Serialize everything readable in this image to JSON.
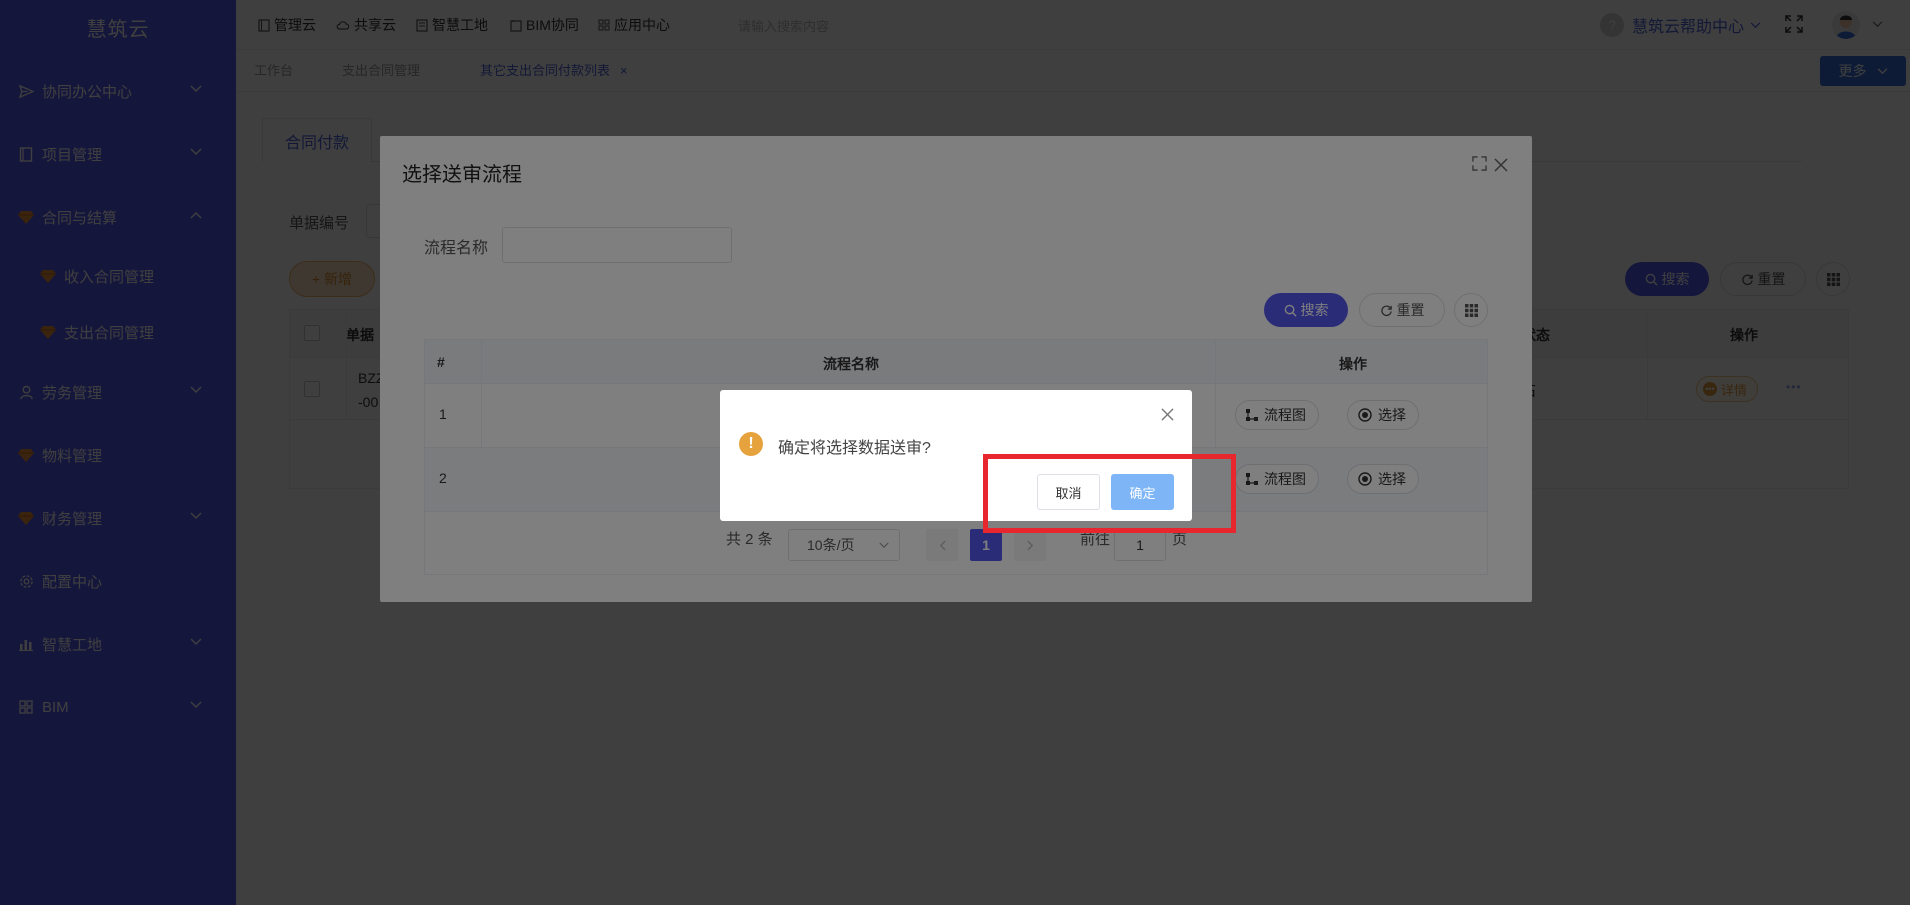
{
  "app": {
    "logo": "慧筑云"
  },
  "sidebar": {
    "items": [
      {
        "label": "协同办公中心",
        "icon": "send-icon",
        "expanded": false
      },
      {
        "label": "项目管理",
        "icon": "book-icon",
        "expanded": false
      },
      {
        "label": "合同与结算",
        "icon": "gem-icon",
        "expanded": true
      },
      {
        "label": "收入合同管理",
        "icon": "gem-icon"
      },
      {
        "label": "支出合同管理",
        "icon": "gem-icon"
      },
      {
        "label": "劳务管理",
        "icon": "worker-icon",
        "expanded": false
      },
      {
        "label": "物料管理",
        "icon": "gem-icon"
      },
      {
        "label": "财务管理",
        "icon": "gem-icon",
        "expanded": false
      },
      {
        "label": "配置中心",
        "icon": "gear-icon"
      },
      {
        "label": "智慧工地",
        "icon": "bar-chart-icon",
        "expanded": false
      },
      {
        "label": "BIM",
        "icon": "grid-icon",
        "expanded": false
      }
    ]
  },
  "topnav": {
    "items": [
      {
        "label": "管理云",
        "icon": "book-icon"
      },
      {
        "label": "共享云",
        "icon": "cloud-icon"
      },
      {
        "label": "智慧工地",
        "icon": "doc-icon"
      },
      {
        "label": "BIM协同",
        "icon": "folder-icon"
      },
      {
        "label": "应用中心",
        "icon": "grid-icon"
      }
    ],
    "search_placeholder": "请输入搜索内容",
    "help": "慧筑云帮助中心"
  },
  "tabs": [
    {
      "label": "工作台",
      "active": false
    },
    {
      "label": "支出合同管理",
      "active": false
    },
    {
      "label": "其它支出合同付款列表",
      "active": true,
      "close": "×"
    }
  ],
  "more_button": "更多",
  "page": {
    "content_tab": "合同付款",
    "filter_label": "单据编号",
    "add_button": "+ 新增",
    "search_button": "搜索",
    "reset_button": "重置",
    "table": {
      "header_cells": [
        "单据",
        "状态",
        "操作"
      ],
      "row_doc": "BZZ",
      "row_doc2": "-00",
      "row_status": "石",
      "detail_button": "详情",
      "more_dots": "•••"
    }
  },
  "dialog": {
    "title": "选择送审流程",
    "field_label": "流程名称",
    "search_button": "搜索",
    "reset_button": "重置",
    "columns": [
      "#",
      "流程名称",
      "操作"
    ],
    "rows": [
      {
        "num": "1",
        "flow_button": "流程图",
        "select_button": "选择"
      },
      {
        "num": "2",
        "flow_button": "流程图",
        "select_button": "选择"
      }
    ],
    "pagination": {
      "total": "共 2 条",
      "page_size": "10条/页",
      "current": "1",
      "goto_label": "前往",
      "goto_value": "1",
      "page_suffix": "页"
    }
  },
  "confirm": {
    "message": "确定将选择数据送审?",
    "cancel": "取消",
    "ok": "确定",
    "icon": "!"
  },
  "colors": {
    "sidebar": "#5659f0",
    "accent": "#4b63d9",
    "primary_button": "#5659f0",
    "highlight": "#e8262d",
    "warning": "#e6a23c",
    "ok_button": "#7eb5f7"
  }
}
